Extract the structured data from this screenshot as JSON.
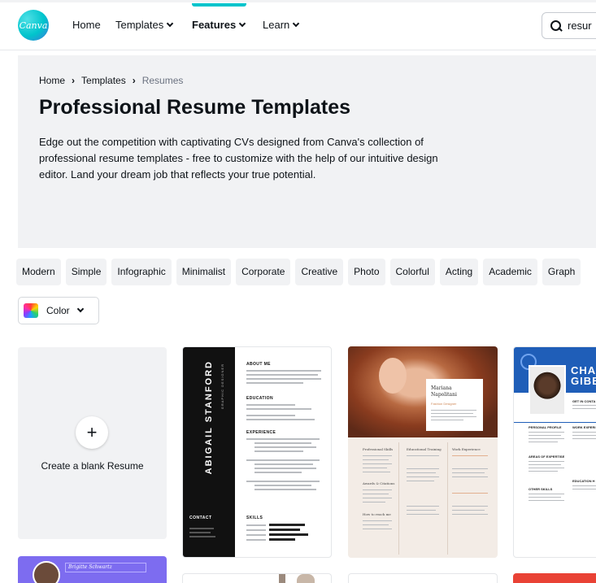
{
  "nav": {
    "logo_text": "Canva",
    "items": [
      {
        "label": "Home",
        "has_dropdown": false,
        "active": false
      },
      {
        "label": "Templates",
        "has_dropdown": true,
        "active": false
      },
      {
        "label": "Features",
        "has_dropdown": true,
        "active": true
      },
      {
        "label": "Learn",
        "has_dropdown": true,
        "active": false
      }
    ],
    "search_value": "resur",
    "accent_color": "#00c4cc"
  },
  "hero": {
    "breadcrumb": [
      "Home",
      "Templates",
      "Resumes"
    ],
    "title": "Professional Resume Templates",
    "description": "Edge out the competition with captivating CVs designed from Canva's collection of professional resume templates - free to customize with the help of our intuitive design editor. Land your dream job that reflects your true potential."
  },
  "filters": {
    "chips": [
      "Modern",
      "Simple",
      "Infographic",
      "Minimalist",
      "Corporate",
      "Creative",
      "Photo",
      "Colorful",
      "Acting",
      "Academic",
      "Graph"
    ],
    "color_label": "Color"
  },
  "cards": {
    "blank_label": "Create a blank Resume",
    "plus_symbol": "+",
    "resume1": {
      "name": "ABIGAIL STANFORD",
      "subtitle": "GRAPHIC DESIGNER",
      "sections": [
        "ABOUT ME",
        "EDUCATION",
        "EXPERIENCE",
        "SKILLS"
      ],
      "contact": "CONTACT"
    },
    "resume2": {
      "name_line1": "Mariana",
      "name_line2": "Napolitani",
      "subtitle": "Fashion Designer",
      "sections": [
        "Professional Skills",
        "Educational Training",
        "Work Experience",
        "Awards & Citations",
        "How to reach me"
      ]
    },
    "resume3": {
      "name_line1": "CHA",
      "name_line2": "GIBE",
      "band_color": "#1f5eb8",
      "sections": [
        "GET IN CONTA",
        "PERSONAL PROFILE",
        "WORK EXPERI",
        "AREAS OF EXPERTISE",
        "EDUCATION H",
        "OTHER SKILLS"
      ]
    },
    "peek1_name": "Brigitte Schwartz"
  }
}
